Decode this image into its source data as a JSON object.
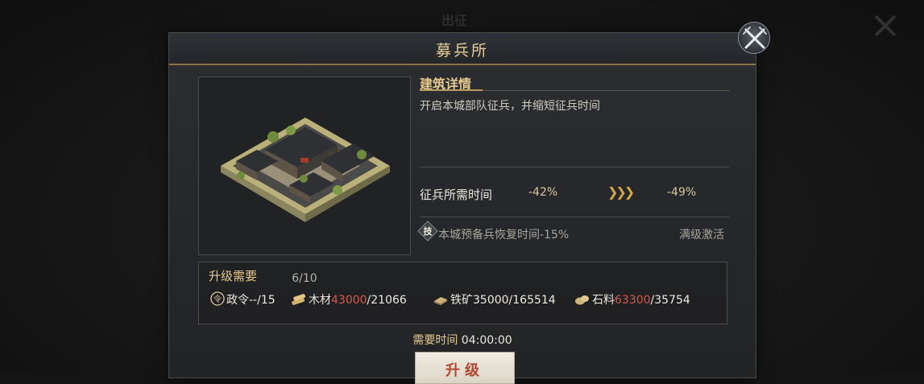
{
  "background": {
    "title": "出征"
  },
  "panel": {
    "title": "募兵所",
    "level": "6/10",
    "details": {
      "heading": "建筑详情",
      "description": "开启本城部队征兵，并缩短征兵时间"
    },
    "stat": {
      "label": "征兵所需时间",
      "current": "-42%",
      "next": "-49%"
    },
    "skill": {
      "badge": "技",
      "text": "本城预备兵恢复时间-15%",
      "status": "满级激活"
    },
    "requirements": {
      "title": "升级需要",
      "items": [
        {
          "icon": "order-icon",
          "name": "政令",
          "required": "--",
          "owned": "/15",
          "sufficient": true
        },
        {
          "icon": "wood-icon",
          "name": "木材",
          "required": "43000",
          "owned": "/21066",
          "sufficient": false
        },
        {
          "icon": "iron-icon",
          "name": "铁矿",
          "required": "35000",
          "owned": "/165514",
          "sufficient": true
        },
        {
          "icon": "stone-icon",
          "name": "石料",
          "required": "63300",
          "owned": "/35754",
          "sufficient": false
        }
      ]
    },
    "time": {
      "label": "需要时间",
      "value": "04:00:00"
    },
    "upgrade_button": "升级"
  },
  "colors": {
    "accent_gold": "#e6c98e",
    "insufficient_red": "#d2584b",
    "arrow_gold": "#d8a943"
  }
}
